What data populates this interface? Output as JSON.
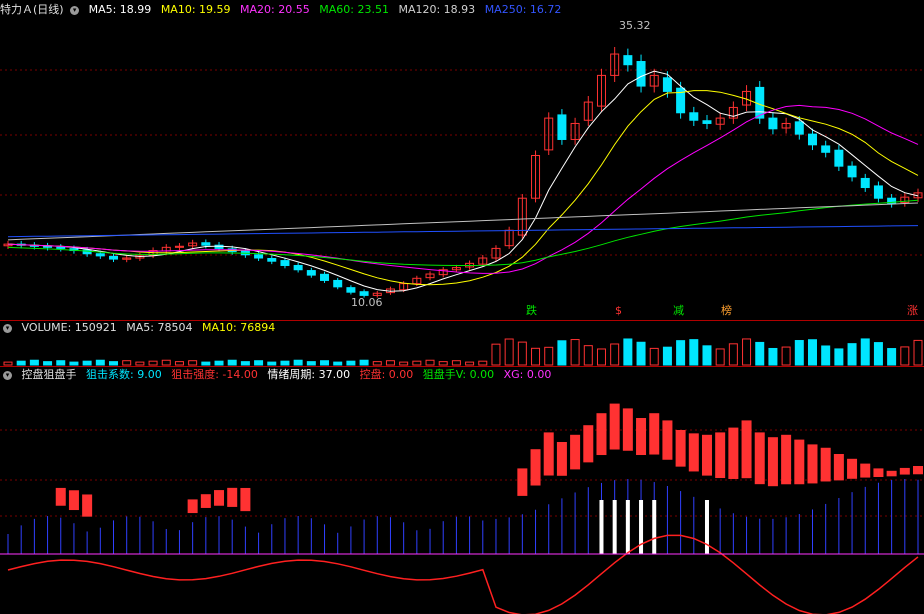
{
  "main_header": {
    "title": "特力Ａ(日线)",
    "ma5": "MA5: 18.99",
    "ma10": "MA10: 19.59",
    "ma20": "MA20: 20.55",
    "ma60": "MA60: 23.51",
    "ma120": "MA120: 18.93",
    "ma250": "MA250: 16.72"
  },
  "annotations": {
    "high": "35.32",
    "low": "10.06",
    "events": [
      "跌",
      "$",
      "减",
      "榜",
      "涨"
    ]
  },
  "volume_header": {
    "volume": "VOLUME: 150921",
    "ma5": "MA5: 78504",
    "ma10": "MA10: 76894"
  },
  "indicator_header": {
    "name": "控盘狙盘手",
    "snipe_coef": "狙击系数: 9.00",
    "snipe_strength": "狙击强度: -14.00",
    "mood_cycle": "情绪周期: 37.00",
    "control": "控盘: 0.00",
    "sniper_v": "狙盘手V: 0.00",
    "xg": "XG: 0.00"
  },
  "colors": {
    "up": "#ff3232",
    "down": "#00e6ff",
    "ma5": "#ffffff",
    "ma10": "#ffff00",
    "ma20": "#ff00ff",
    "ma60": "#00e600",
    "ma120": "#c0c0c0",
    "ma250": "#2050ff",
    "separator": "#b00000"
  },
  "chart_data": {
    "type": "candlestick",
    "price_annotations": {
      "high": 35.32,
      "low": 10.06
    },
    "last_values": {
      "ma5": 18.99,
      "ma10": 19.59,
      "ma20": 20.55,
      "ma60": 23.51,
      "ma120": 18.93,
      "ma250": 16.72,
      "volume": 150921,
      "volume_ma5": 78504,
      "volume_ma10": 76894,
      "snipe_coef": 9.0,
      "snipe_strength": -14.0,
      "mood_cycle": 37.0,
      "control": 0.0,
      "sniper_v": 0.0,
      "xg": 0.0
    },
    "close_estimate": [
      15.2,
      15.1,
      15.0,
      14.9,
      14.8,
      14.6,
      14.3,
      14.1,
      13.8,
      13.9,
      14.1,
      14.6,
      14.9,
      15.0,
      15.3,
      15.1,
      14.8,
      14.5,
      14.2,
      13.9,
      13.6,
      13.2,
      12.8,
      12.3,
      11.8,
      11.2,
      10.7,
      10.4,
      10.6,
      11.0,
      11.5,
      12.0,
      12.4,
      12.8,
      13.0,
      13.4,
      13.9,
      14.8,
      16.5,
      19.5,
      23.5,
      27.0,
      25.0,
      26.5,
      28.5,
      31.0,
      33.0,
      32.0,
      30.0,
      31.0,
      29.5,
      27.5,
      26.8,
      26.5,
      27.0,
      28.0,
      29.5,
      27.0,
      26.0,
      26.5,
      25.5,
      24.5,
      23.8,
      22.5,
      21.5,
      20.5,
      19.5,
      19.0,
      19.6,
      20.0
    ]
  }
}
